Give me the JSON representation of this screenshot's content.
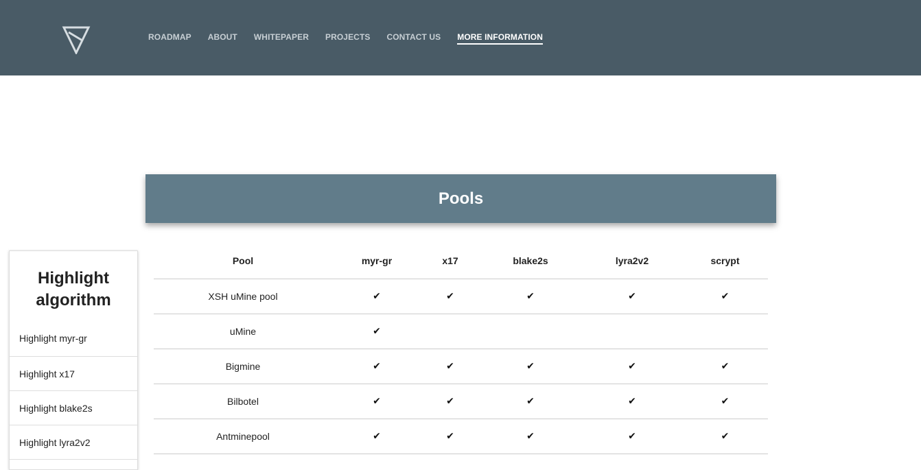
{
  "nav": {
    "items": [
      "ROADMAP",
      "ABOUT",
      "WHITEPAPER",
      "PROJECTS",
      "CONTACT US",
      "MORE INFORMATION"
    ],
    "active": "MORE INFORMATION"
  },
  "banner": {
    "title": "Pools"
  },
  "sidebar": {
    "title": "Highlight algorithm",
    "items": [
      "Highlight myr-gr",
      "Highlight x17",
      "Highlight blake2s",
      "Highlight lyra2v2"
    ]
  },
  "table": {
    "headers": [
      "Pool",
      "myr-gr",
      "x17",
      "blake2s",
      "lyra2v2",
      "scrypt"
    ],
    "check_glyph": "✔",
    "rows": [
      {
        "name": "XSH uMine pool",
        "support": [
          true,
          true,
          true,
          true,
          true
        ]
      },
      {
        "name": "uMine",
        "support": [
          true,
          false,
          false,
          false,
          false
        ]
      },
      {
        "name": "Bigmine",
        "support": [
          true,
          true,
          true,
          true,
          true
        ]
      },
      {
        "name": "Bilbotel",
        "support": [
          true,
          true,
          true,
          true,
          true
        ]
      },
      {
        "name": "Antminepool",
        "support": [
          true,
          true,
          true,
          true,
          true
        ]
      }
    ]
  },
  "colors": {
    "header_bg": "#495b66",
    "banner_bg": "#617c8a"
  }
}
